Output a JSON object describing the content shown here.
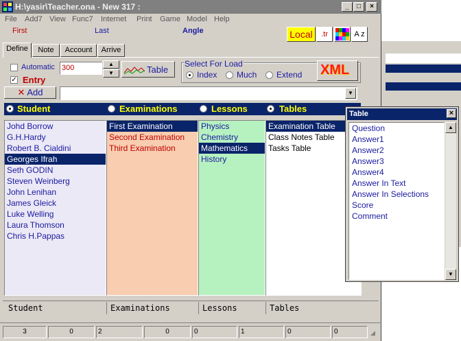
{
  "window": {
    "title": "H:\\yasir\\Teacher.ona - New 317 :",
    "min": "_",
    "max": "□",
    "close": "×"
  },
  "menu": [
    "File",
    "Add7",
    "View",
    "Func7",
    "Internet",
    "Print",
    "Game",
    "Model",
    "Help"
  ],
  "nav": {
    "first": "First",
    "last": "Last",
    "angle": "Angle"
  },
  "tools": {
    "local": "Local",
    "tr": ".tr",
    "az": "A z"
  },
  "tabs": [
    "Define",
    "Note",
    "Account",
    "Arrive"
  ],
  "define": {
    "automatic": "Automatic",
    "value": "300",
    "entry": "Entry",
    "add": "Add",
    "table": "Table",
    "select_for_load": "Select For Load",
    "load_options": [
      "Index",
      "Much",
      "Extend"
    ],
    "xml": "XML"
  },
  "headers": [
    "Student",
    "Examinations",
    "Lessons",
    "Tables"
  ],
  "students": [
    "Johd Borrow",
    "G.H.Hardy",
    "Robert B. Cialdini",
    "Georges Ifrah",
    "Seth GODIN",
    "Steven Weinberg",
    "John Lenihan",
    "James Gleick",
    "Luke Welling",
    "Laura Thomson",
    "Chris H.Pappas"
  ],
  "examinations": [
    "First Examination",
    "Second Examination",
    "Third Examination"
  ],
  "lessons": [
    "Physics",
    "Chemistry",
    "Mathematics",
    "History"
  ],
  "tables": [
    "Examination Table",
    "Class Notes Table",
    "Tasks Table"
  ],
  "footer": [
    "Student",
    "Examinations",
    "Lessons",
    "Tables"
  ],
  "status": [
    "3",
    "0",
    "2",
    "0",
    "0",
    "1",
    "0",
    "0"
  ],
  "popup": {
    "title": "Table",
    "close": "×",
    "items": [
      "Question",
      "Answer1",
      "Answer2",
      "Answer3",
      "Answer4",
      "Answer In Text",
      "Answer In Selections",
      "Score",
      "Comment"
    ]
  },
  "colors": {
    "titlebar": "#808080",
    "header": "#0a246a",
    "header_text": "#ffff00",
    "students_bg": "#ece9f6",
    "exams_bg": "#f8cdb0",
    "lessons_bg": "#b6f2c0"
  }
}
